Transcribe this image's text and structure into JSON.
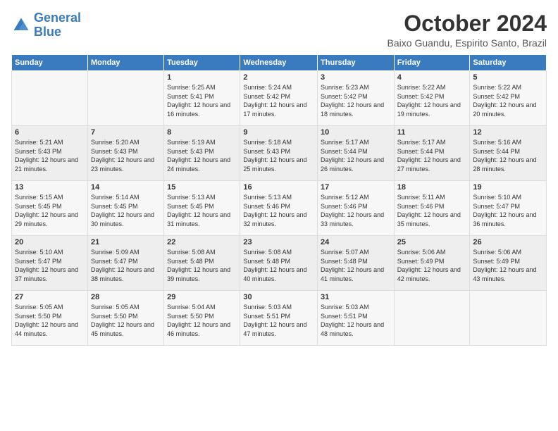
{
  "logo": {
    "line1": "General",
    "line2": "Blue"
  },
  "title": "October 2024",
  "location": "Baixo Guandu, Espirito Santo, Brazil",
  "days_of_week": [
    "Sunday",
    "Monday",
    "Tuesday",
    "Wednesday",
    "Thursday",
    "Friday",
    "Saturday"
  ],
  "weeks": [
    [
      {
        "day": "",
        "info": ""
      },
      {
        "day": "",
        "info": ""
      },
      {
        "day": "1",
        "info": "Sunrise: 5:25 AM\nSunset: 5:41 PM\nDaylight: 12 hours and 16 minutes."
      },
      {
        "day": "2",
        "info": "Sunrise: 5:24 AM\nSunset: 5:42 PM\nDaylight: 12 hours and 17 minutes."
      },
      {
        "day": "3",
        "info": "Sunrise: 5:23 AM\nSunset: 5:42 PM\nDaylight: 12 hours and 18 minutes."
      },
      {
        "day": "4",
        "info": "Sunrise: 5:22 AM\nSunset: 5:42 PM\nDaylight: 12 hours and 19 minutes."
      },
      {
        "day": "5",
        "info": "Sunrise: 5:22 AM\nSunset: 5:42 PM\nDaylight: 12 hours and 20 minutes."
      }
    ],
    [
      {
        "day": "6",
        "info": "Sunrise: 5:21 AM\nSunset: 5:43 PM\nDaylight: 12 hours and 21 minutes."
      },
      {
        "day": "7",
        "info": "Sunrise: 5:20 AM\nSunset: 5:43 PM\nDaylight: 12 hours and 23 minutes."
      },
      {
        "day": "8",
        "info": "Sunrise: 5:19 AM\nSunset: 5:43 PM\nDaylight: 12 hours and 24 minutes."
      },
      {
        "day": "9",
        "info": "Sunrise: 5:18 AM\nSunset: 5:43 PM\nDaylight: 12 hours and 25 minutes."
      },
      {
        "day": "10",
        "info": "Sunrise: 5:17 AM\nSunset: 5:44 PM\nDaylight: 12 hours and 26 minutes."
      },
      {
        "day": "11",
        "info": "Sunrise: 5:17 AM\nSunset: 5:44 PM\nDaylight: 12 hours and 27 minutes."
      },
      {
        "day": "12",
        "info": "Sunrise: 5:16 AM\nSunset: 5:44 PM\nDaylight: 12 hours and 28 minutes."
      }
    ],
    [
      {
        "day": "13",
        "info": "Sunrise: 5:15 AM\nSunset: 5:45 PM\nDaylight: 12 hours and 29 minutes."
      },
      {
        "day": "14",
        "info": "Sunrise: 5:14 AM\nSunset: 5:45 PM\nDaylight: 12 hours and 30 minutes."
      },
      {
        "day": "15",
        "info": "Sunrise: 5:13 AM\nSunset: 5:45 PM\nDaylight: 12 hours and 31 minutes."
      },
      {
        "day": "16",
        "info": "Sunrise: 5:13 AM\nSunset: 5:46 PM\nDaylight: 12 hours and 32 minutes."
      },
      {
        "day": "17",
        "info": "Sunrise: 5:12 AM\nSunset: 5:46 PM\nDaylight: 12 hours and 33 minutes."
      },
      {
        "day": "18",
        "info": "Sunrise: 5:11 AM\nSunset: 5:46 PM\nDaylight: 12 hours and 35 minutes."
      },
      {
        "day": "19",
        "info": "Sunrise: 5:10 AM\nSunset: 5:47 PM\nDaylight: 12 hours and 36 minutes."
      }
    ],
    [
      {
        "day": "20",
        "info": "Sunrise: 5:10 AM\nSunset: 5:47 PM\nDaylight: 12 hours and 37 minutes."
      },
      {
        "day": "21",
        "info": "Sunrise: 5:09 AM\nSunset: 5:47 PM\nDaylight: 12 hours and 38 minutes."
      },
      {
        "day": "22",
        "info": "Sunrise: 5:08 AM\nSunset: 5:48 PM\nDaylight: 12 hours and 39 minutes."
      },
      {
        "day": "23",
        "info": "Sunrise: 5:08 AM\nSunset: 5:48 PM\nDaylight: 12 hours and 40 minutes."
      },
      {
        "day": "24",
        "info": "Sunrise: 5:07 AM\nSunset: 5:48 PM\nDaylight: 12 hours and 41 minutes."
      },
      {
        "day": "25",
        "info": "Sunrise: 5:06 AM\nSunset: 5:49 PM\nDaylight: 12 hours and 42 minutes."
      },
      {
        "day": "26",
        "info": "Sunrise: 5:06 AM\nSunset: 5:49 PM\nDaylight: 12 hours and 43 minutes."
      }
    ],
    [
      {
        "day": "27",
        "info": "Sunrise: 5:05 AM\nSunset: 5:50 PM\nDaylight: 12 hours and 44 minutes."
      },
      {
        "day": "28",
        "info": "Sunrise: 5:05 AM\nSunset: 5:50 PM\nDaylight: 12 hours and 45 minutes."
      },
      {
        "day": "29",
        "info": "Sunrise: 5:04 AM\nSunset: 5:50 PM\nDaylight: 12 hours and 46 minutes."
      },
      {
        "day": "30",
        "info": "Sunrise: 5:03 AM\nSunset: 5:51 PM\nDaylight: 12 hours and 47 minutes."
      },
      {
        "day": "31",
        "info": "Sunrise: 5:03 AM\nSunset: 5:51 PM\nDaylight: 12 hours and 48 minutes."
      },
      {
        "day": "",
        "info": ""
      },
      {
        "day": "",
        "info": ""
      }
    ]
  ]
}
